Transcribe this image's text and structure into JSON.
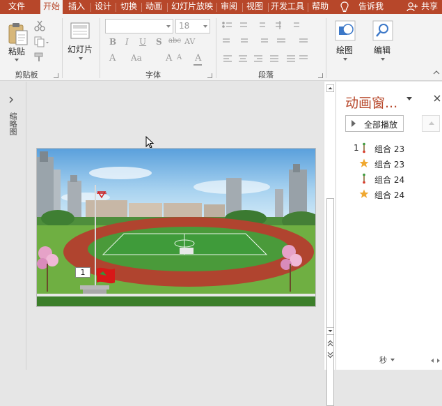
{
  "tabs": [
    {
      "label": "文件",
      "active": false
    },
    {
      "label": "开始",
      "active": true
    },
    {
      "label": "插入",
      "active": false
    },
    {
      "label": "设计",
      "active": false
    },
    {
      "label": "切换",
      "active": false
    },
    {
      "label": "动画",
      "active": false
    },
    {
      "label": "幻灯片放映",
      "active": false
    },
    {
      "label": "审阅",
      "active": false
    },
    {
      "label": "视图",
      "active": false
    },
    {
      "label": "开发工具",
      "active": false
    },
    {
      "label": "帮助",
      "active": false
    }
  ],
  "tell_me": "告诉我",
  "share": "共享",
  "ribbon": {
    "clipboard": {
      "paste_label": "粘贴",
      "group_label": "剪贴板"
    },
    "slides": {
      "new_slide_label": "幻灯片"
    },
    "font": {
      "font_name_value": "",
      "font_size_value": "18",
      "group_label": "字体"
    },
    "paragraph": {
      "group_label": "段落"
    },
    "drawing": {
      "label": "绘图"
    },
    "editing": {
      "label": "编辑"
    }
  },
  "left_pane": {
    "label": "缩略图"
  },
  "slide": {
    "trigger_number": "1"
  },
  "animation_pane": {
    "title": "动画窗...",
    "play_all_label": "全部播放",
    "items": [
      {
        "number": "1",
        "effect_icon": "path-line-icon",
        "label": "组合 23",
        "color": "#b7472a"
      },
      {
        "number": "",
        "effect_icon": "star-icon",
        "label": "组合 23",
        "color": "#f0a030"
      },
      {
        "number": "",
        "effect_icon": "path-line-icon",
        "label": "组合 24",
        "color": "#b7472a"
      },
      {
        "number": "",
        "effect_icon": "star-icon",
        "label": "组合 24",
        "color": "#f0a030"
      }
    ],
    "seconds_label": "秒"
  },
  "colors": {
    "accent": "#b7472a",
    "ribbon_bg": "#f3f3f3",
    "canvas_bg": "#e6e6e6"
  }
}
